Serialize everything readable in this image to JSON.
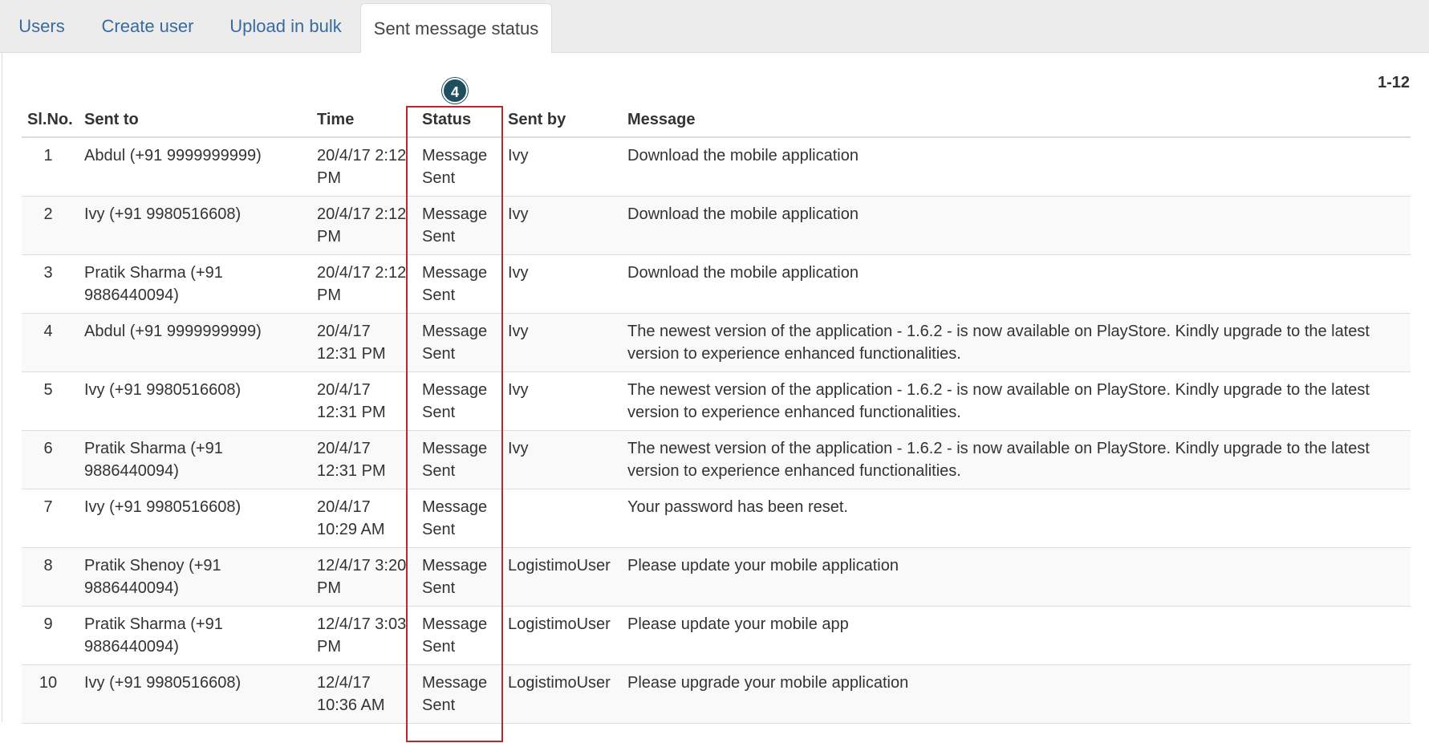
{
  "tabs": [
    {
      "label": "Users"
    },
    {
      "label": "Create user"
    },
    {
      "label": "Upload in bulk"
    },
    {
      "label": "Sent message status",
      "active": true
    }
  ],
  "pager": {
    "range": "1-12"
  },
  "annotation": {
    "step": "4",
    "box_color": "#b52a2a",
    "badge_color": "#1f4e5f"
  },
  "table": {
    "headers": {
      "sl": "Sl.No.",
      "sent_to": "Sent to",
      "time": "Time",
      "status": "Status",
      "sent_by": "Sent by",
      "message": "Message"
    },
    "rows": [
      {
        "sl": "1",
        "sent_to": "Abdul (+91 9999999999)",
        "time": "20/4/17 2:12 PM",
        "status": "Message Sent",
        "sent_by": "Ivy",
        "message": "Download the mobile application"
      },
      {
        "sl": "2",
        "sent_to": "Ivy (+91 9980516608)",
        "time": "20/4/17 2:12 PM",
        "status": "Message Sent",
        "sent_by": "Ivy",
        "message": "Download the mobile application"
      },
      {
        "sl": "3",
        "sent_to": "Pratik Sharma (+91 9886440094)",
        "time": "20/4/17 2:12 PM",
        "status": "Message Sent",
        "sent_by": "Ivy",
        "message": "Download the mobile application"
      },
      {
        "sl": "4",
        "sent_to": "Abdul (+91 9999999999)",
        "time": "20/4/17 12:31 PM",
        "status": "Message Sent",
        "sent_by": "Ivy",
        "message": "The newest version of the application - 1.6.2 - is now available on PlayStore. Kindly upgrade to the latest version to experience enhanced functionalities."
      },
      {
        "sl": "5",
        "sent_to": "Ivy (+91 9980516608)",
        "time": "20/4/17 12:31 PM",
        "status": "Message Sent",
        "sent_by": "Ivy",
        "message": "The newest version of the application - 1.6.2 - is now available on PlayStore. Kindly upgrade to the latest version to experience enhanced functionalities."
      },
      {
        "sl": "6",
        "sent_to": "Pratik Sharma (+91 9886440094)",
        "time": "20/4/17 12:31 PM",
        "status": "Message Sent",
        "sent_by": "Ivy",
        "message": "The newest version of the application - 1.6.2 - is now available on PlayStore. Kindly upgrade to the latest version to experience enhanced functionalities."
      },
      {
        "sl": "7",
        "sent_to": "Ivy (+91 9980516608)",
        "time": "20/4/17 10:29 AM",
        "status": "Message Sent",
        "sent_by": "",
        "message": "Your password has been reset."
      },
      {
        "sl": "8",
        "sent_to": "Pratik Shenoy (+91 9886440094)",
        "time": "12/4/17 3:20 PM",
        "status": "Message Sent",
        "sent_by": "LogistimoUser",
        "message": "Please update your mobile application"
      },
      {
        "sl": "9",
        "sent_to": "Pratik Sharma (+91 9886440094)",
        "time": "12/4/17 3:03 PM",
        "status": "Message Sent",
        "sent_by": "LogistimoUser",
        "message": "Please update your mobile app"
      },
      {
        "sl": "10",
        "sent_to": "Ivy (+91 9980516608)",
        "time": "12/4/17 10:36 AM",
        "status": "Message Sent",
        "sent_by": "LogistimoUser",
        "message": "Please upgrade your mobile application"
      }
    ]
  }
}
